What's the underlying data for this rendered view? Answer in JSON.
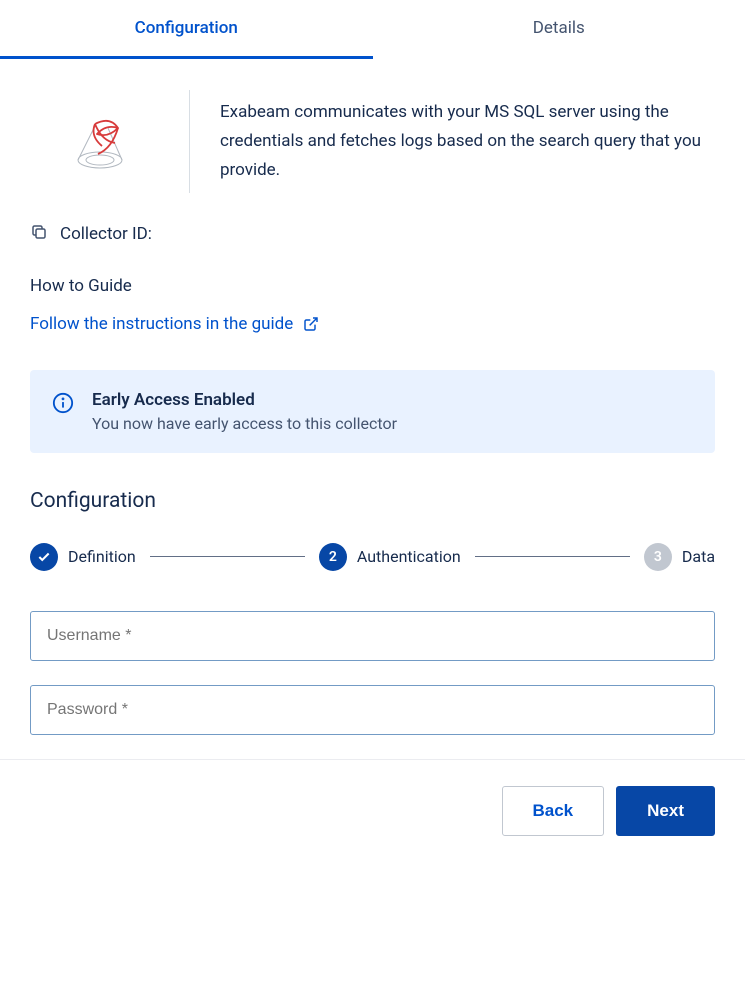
{
  "tabs": {
    "configuration": "Configuration",
    "details": "Details"
  },
  "intro": {
    "description": "Exabeam communicates with your MS SQL server using the credentials and fetches logs based on the search query that you provide."
  },
  "collector": {
    "label": "Collector ID:"
  },
  "howto": {
    "heading": "How to Guide",
    "link": "Follow the instructions in the guide"
  },
  "banner": {
    "title": "Early Access Enabled",
    "body": "You now have early access to this collector"
  },
  "section": {
    "heading": "Configuration"
  },
  "stepper": {
    "step1": {
      "label": "Definition"
    },
    "step2": {
      "num": "2",
      "label": "Authentication"
    },
    "step3": {
      "num": "3",
      "label": "Data"
    }
  },
  "form": {
    "username_placeholder": "Username *",
    "password_placeholder": "Password *"
  },
  "footer": {
    "back": "Back",
    "next": "Next"
  }
}
